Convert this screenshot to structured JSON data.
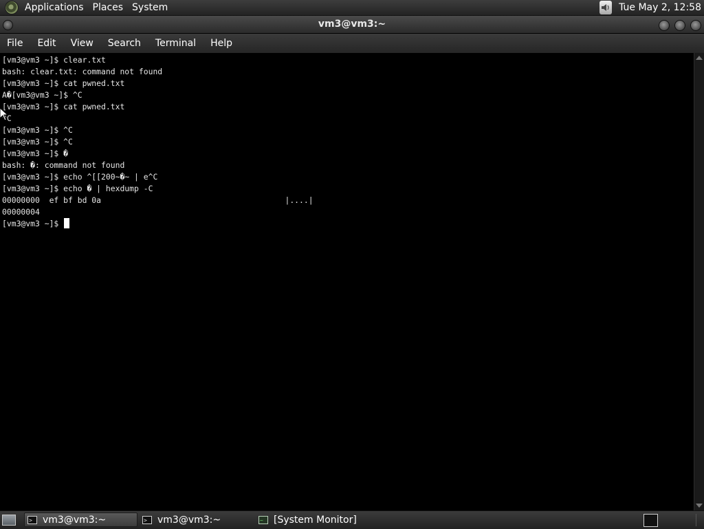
{
  "top_panel": {
    "menus": [
      "Applications",
      "Places",
      "System"
    ],
    "clock": "Tue May  2, 12:58"
  },
  "window": {
    "title": "vm3@vm3:~",
    "menu": [
      "File",
      "Edit",
      "View",
      "Search",
      "Terminal",
      "Help"
    ]
  },
  "terminal": {
    "lines": [
      "[vm3@vm3 ~]$ clear.txt",
      "bash: clear.txt: command not found",
      "[vm3@vm3 ~]$ cat pwned.txt",
      "A�[vm3@vm3 ~]$ ^C",
      "[vm3@vm3 ~]$ cat pwned.txt",
      "^C",
      "[vm3@vm3 ~]$ ^C",
      "[vm3@vm3 ~]$ ^C",
      "[vm3@vm3 ~]$ �",
      "bash: �: command not found",
      "[vm3@vm3 ~]$ echo ^[[200~�~ | e^C",
      "[vm3@vm3 ~]$ echo � | hexdump -C",
      "00000000  ef bf bd 0a                                       |....|",
      "00000004",
      "[vm3@vm3 ~]$ "
    ]
  },
  "taskbar": {
    "tasks": [
      {
        "label": "vm3@vm3:~",
        "icon": "terminal-icon",
        "active": true
      },
      {
        "label": "vm3@vm3:~",
        "icon": "terminal-icon",
        "active": false
      },
      {
        "label": "[System Monitor]",
        "icon": "system-monitor-icon",
        "active": false
      }
    ]
  },
  "icons": {
    "panel_logo": "app-menu-logo-icon",
    "volume": "volume-icon",
    "show_desktop": "show-desktop-icon",
    "tray_terminal": "terminal-icon"
  },
  "colors": {
    "terminal_bg": "#000000",
    "terminal_fg": "#e6e6e6",
    "panel_bg": "#2f2f2f"
  }
}
